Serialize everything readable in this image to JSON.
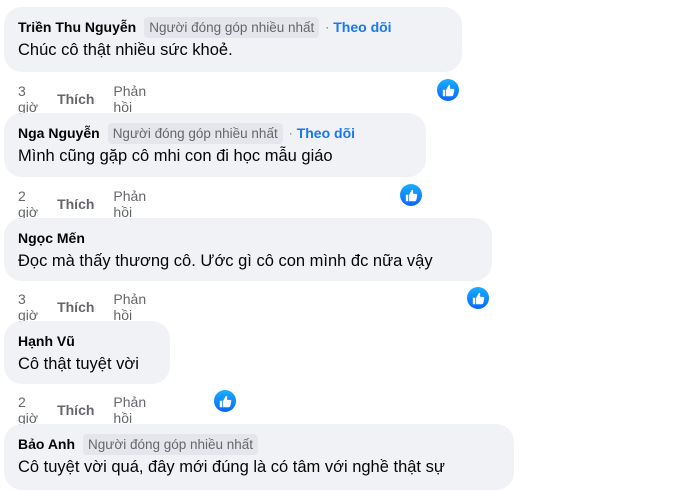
{
  "colors": {
    "bubble": "#f0f2f5",
    "badge_bg": "#e4e6eb",
    "muted_text": "#65676b",
    "link": "#1877f2",
    "like_reaction": "#0866ff"
  },
  "comments": [
    {
      "author": "Triền Thu Nguyễn",
      "badge": "Người đóng góp nhiều nhất",
      "follow": "Theo dõi",
      "text": "Chúc cô thật nhiều sức khoẻ.",
      "time": "3 giờ",
      "like_label": "Thích",
      "reply_label": "Phản hồi",
      "reaction_icon": "like-reaction-icon"
    },
    {
      "author": "Nga Nguyễn",
      "badge": "Người đóng góp nhiều nhất",
      "follow": "Theo dõi",
      "text": "Mình cũng gặp cô mhi con đi học mẫu giáo",
      "time": "2 giờ",
      "like_label": "Thích",
      "reply_label": "Phản hồi",
      "reaction_icon": "like-reaction-icon"
    },
    {
      "author": "Ngọc Mến",
      "text": "Đọc mà thấy thương cô. Ước gì cô con mình đc nữa vậy",
      "time": "3 giờ",
      "like_label": "Thích",
      "reply_label": "Phản hồi",
      "reaction_icon": "like-reaction-icon"
    },
    {
      "author": "Hạnh Vũ",
      "text": "Cô thật tuyệt vời",
      "time": "2 giờ",
      "like_label": "Thích",
      "reply_label": "Phản hồi",
      "reaction_icon": "like-reaction-icon"
    },
    {
      "author": "Bảo Anh",
      "badge": "Người đóng góp nhiều nhất",
      "text": "Cô tuyệt vời quá, đây mới đúng là có tâm với nghề thật sự"
    }
  ]
}
